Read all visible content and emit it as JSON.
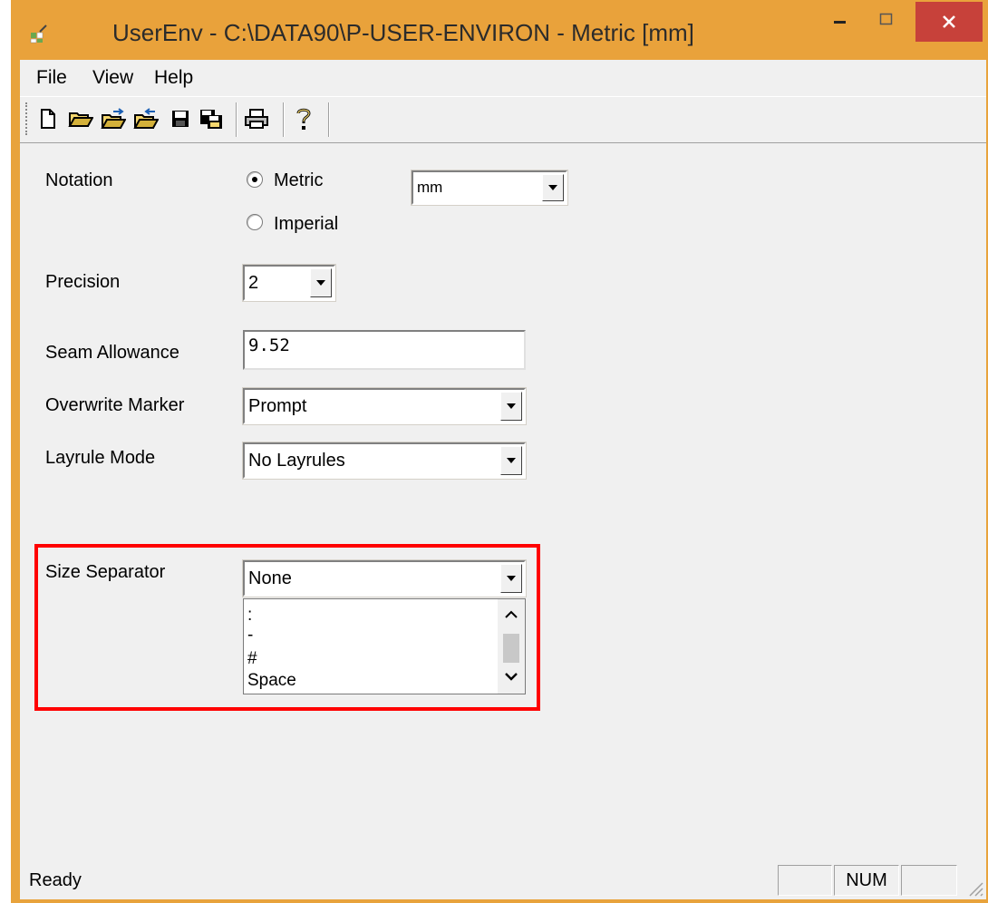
{
  "window": {
    "title": "UserEnv - C:\\DATA90\\P-USER-ENVIRON - Metric [mm]",
    "accent_color": "#e9a23b",
    "close_color": "#c7413a"
  },
  "menu": {
    "items": [
      "File",
      "View",
      "Help"
    ]
  },
  "toolbar": {
    "buttons": [
      "new-document-icon",
      "open-folder-icon",
      "open-folder-arrow-icon",
      "folder-back-icon",
      "save-icon",
      "save-all-icon",
      "print-icon",
      "help-icon"
    ]
  },
  "form": {
    "notation": {
      "label": "Notation",
      "options": [
        "Metric",
        "Imperial"
      ],
      "selected": "Metric",
      "unit_value": "mm"
    },
    "precision": {
      "label": "Precision",
      "value": "2"
    },
    "seam_allowance": {
      "label": "Seam Allowance",
      "value": "9.52"
    },
    "overwrite_marker": {
      "label": "Overwrite Marker",
      "value": "Prompt"
    },
    "layrule_mode": {
      "label": "Layrule Mode",
      "value": "No Layrules"
    },
    "size_separator": {
      "label": "Size Separator",
      "value": "None",
      "options": [
        ":",
        "-",
        "#",
        "Space"
      ]
    }
  },
  "highlight_color": "#ff0000",
  "status": {
    "text": "Ready",
    "num": "NUM"
  }
}
